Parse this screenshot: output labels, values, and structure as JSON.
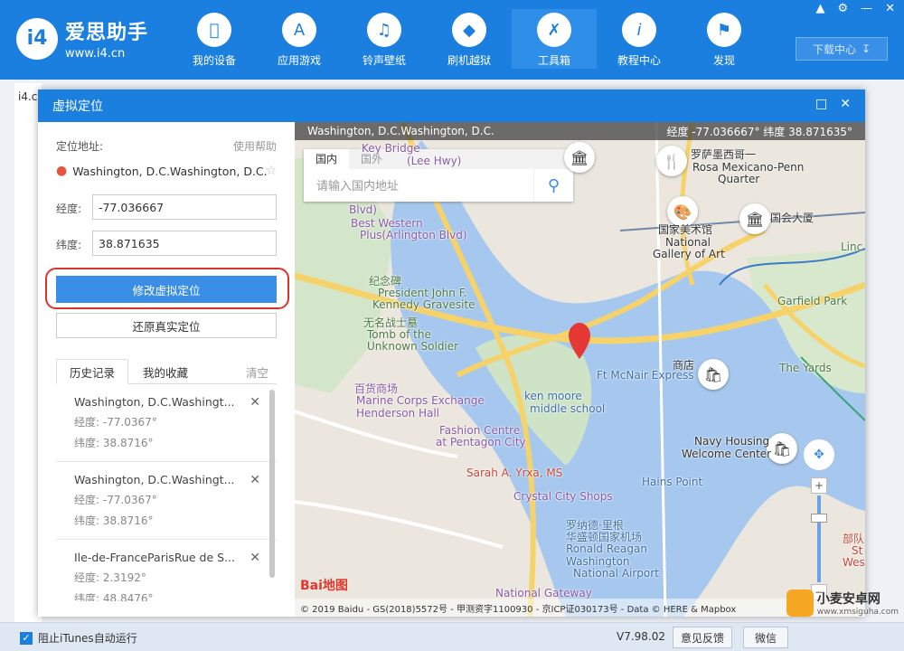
{
  "app": {
    "title": "爱思助手",
    "url": "www.i4.cn",
    "logo": "i4"
  },
  "nav": [
    {
      "label": "我的设备",
      "icon": "apple-icon"
    },
    {
      "label": "应用游戏",
      "icon": "app-store-icon"
    },
    {
      "label": "铃声壁纸",
      "icon": "music-icon"
    },
    {
      "label": "刷机越狱",
      "icon": "dropbox-icon"
    },
    {
      "label": "工具箱",
      "icon": "tools-icon"
    },
    {
      "label": "教程中心",
      "icon": "info-icon"
    },
    {
      "label": "发现",
      "icon": "flag-icon"
    }
  ],
  "download_center": "下载中心",
  "bg_tab": "i4.c",
  "dialog": {
    "title": "虚拟定位",
    "location_label": "定位地址:",
    "help": "使用帮助",
    "address": "Washington, D.C.Washington, D.C.",
    "longitude_label": "经度:",
    "longitude": "-77.036667",
    "latitude_label": "纬度:",
    "latitude": "38.871635",
    "modify_btn": "修改虚拟定位",
    "restore_btn": "还原真实定位",
    "tab_history": "历史记录",
    "tab_favorites": "我的收藏",
    "clear": "清空",
    "history": [
      {
        "name": "Washington, D.C.Washingt...",
        "lng": "经度: -77.0367°",
        "lat": "纬度: 38.8716°"
      },
      {
        "name": "Washington, D.C.Washingt...",
        "lng": "经度: -77.0367°",
        "lat": "纬度: 38.8716°"
      },
      {
        "name": "Ile-de-FranceParisRue de S...",
        "lng": "经度: 2.3192°",
        "lat": "纬度: 48.8476°"
      }
    ]
  },
  "map": {
    "header_location": "Washington, D.C.Washington, D.C.",
    "header_coords": "经度 -77.036667°   纬度 38.871635°",
    "search_tab_domestic": "国内",
    "search_tab_foreign": "国外",
    "search_placeholder": "请输入国内地址",
    "labels": {
      "key_bridge": "Key Bridge",
      "lee_hwy": "(Lee Hwy)",
      "blvd": "Blvd)",
      "best_western": "Best Western",
      "best_western2": "Plus(Arlington Blvd)",
      "memorial_cn": "纪念碑",
      "memorial": "President John F.",
      "memorial2": "Kennedy Gravesite",
      "tomb_cn": "无名战士墓",
      "tomb": "Tomb of the",
      "tomb2": "Unknown Soldier",
      "mall_cn": "百货商场",
      "mall": "Marine Corps Exchange",
      "mall2": "Henderson Hall",
      "fashion": "Fashion Centre",
      "fashion2": "at Pentagon City",
      "sarah": "Sarah A. Yrxa, MS",
      "crystal": "Crystal City Shops",
      "airport_cn": "罗纳德·里根",
      "airport_cn2": "华盛顿国家机场",
      "airport": "Ronald Reagan",
      "airport2": "Washington",
      "airport3": "National Airport",
      "gateway": "National Gateway",
      "ken_moore": "ken moore",
      "ken_moore2": "middle school",
      "mcnair": "Ft McNair Express",
      "shop": "商店",
      "hains": "Hains Point",
      "navy": "Navy Housing",
      "navy2": "Welcome Center",
      "rosa_cn": "罗萨墨西哥一",
      "rosa": "Rosa Mexicano-Penn",
      "rosa2": "Quarter",
      "gallery_cn": "国家美术馆",
      "gallery": "National",
      "gallery2": "Gallery of Art",
      "capitol": "国会大厦",
      "garfield": "Garfield Park",
      "yards": "The Yards",
      "linc": "Linc",
      "south": "部队",
      "st": "St",
      "wes": "Wes"
    },
    "logo": "Bai地图",
    "copyright": "© 2019 Baidu - GS(2018)5572号 - 甲测资字1100930 - 京ICP证030173号 - Data © HERE & Mapbox"
  },
  "bottom": {
    "itunes": "阻止iTunes自动运行",
    "version": "V7.98.02",
    "feedback": "意见反馈",
    "wechat": "微信",
    "watermark": "小麦安卓网",
    "watermark_url": "www.xmsiguha.com"
  },
  "colors": {
    "brand": "#1b7fe0",
    "water": "#a6c8ef",
    "road": "#f7d36b",
    "park": "#cfe3c6",
    "highlight": "#d9342a",
    "pin": "#e53935"
  }
}
